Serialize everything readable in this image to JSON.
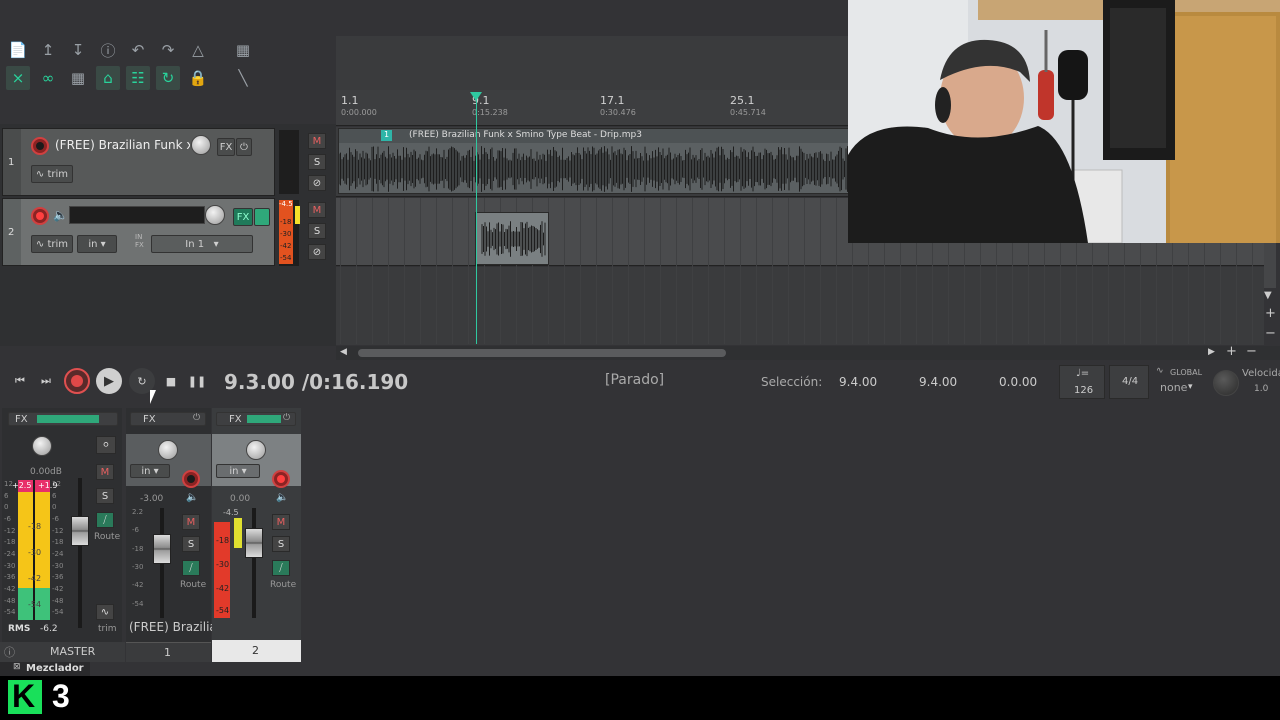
{
  "toolbar": {
    "icons_row1": [
      "new-file-icon",
      "open-icon",
      "save-icon",
      "info-icon",
      "undo-icon",
      "redo-icon",
      "metronome-icon",
      "grid-icon"
    ],
    "icons_row2": [
      "ripple-edit-icon",
      "link-icon",
      "snap-icon",
      "lock-items-icon",
      "grid-lines-icon",
      "loop-icon",
      "lock-icon",
      "trim-tool-icon"
    ]
  },
  "tracks": [
    {
      "number": "1",
      "name": "(FREE) Brazilian Funk x S",
      "fx": "FX",
      "automation": "trim",
      "m": "M",
      "s": "S"
    },
    {
      "number": "2",
      "name": "",
      "fx": "FX",
      "automation": "trim",
      "input_label": "in",
      "input_fx": "IN FX",
      "input": "In 1",
      "m": "M",
      "s": "S",
      "meter_top": "-4.5",
      "meter_labels": [
        "-18",
        "-30",
        "-42",
        "-54"
      ]
    }
  ],
  "ruler": {
    "marks": [
      {
        "bar": "1.1",
        "time": "0:00.000"
      },
      {
        "bar": "9.1",
        "time": "0:15.238"
      },
      {
        "bar": "17.1",
        "time": "0:30.476"
      },
      {
        "bar": "25.1",
        "time": "0:45.714"
      }
    ]
  },
  "item": {
    "title": "(FREE) Brazilian Funk x Smino Type Beat - Drip.mp3",
    "badge": "1"
  },
  "transport": {
    "position": "9.3.00 /0:16.190",
    "status": "[Parado]",
    "selection_label": "Selección:",
    "sel_start": "9.4.00",
    "sel_end": "9.4.00",
    "sel_length": "0.0.00",
    "bpm": "126",
    "bpm_icon": "♩=",
    "time_sig": "4/4",
    "global_label": "GLOBAL",
    "global_value": "none",
    "rate_label": "Velocidad",
    "rate_value": "1.0"
  },
  "mixer": {
    "master": {
      "fx": "FX",
      "volume": "0.00dB",
      "peak_l": "+2.5",
      "peak_r": "+1.9",
      "scale": [
        "12",
        "6",
        "0",
        "-6",
        "-12",
        "-18",
        "-24",
        "-30",
        "-36",
        "-42",
        "-48",
        "-54"
      ],
      "meter_labels": [
        "-18",
        "-30",
        "-42",
        "-54"
      ],
      "m": "M",
      "s": "S",
      "route": "Route",
      "trim": "trim",
      "rms_label": "RMS",
      "rms_value": "-6.2",
      "name": "MASTER"
    },
    "channels": [
      {
        "number": "1",
        "fx": "FX",
        "input": "in",
        "volume": "-3.00",
        "scale": [
          "2.2",
          "-6",
          "-18",
          "-30",
          "-42",
          "-54"
        ],
        "m": "M",
        "s": "S",
        "route": "Route",
        "name": "(FREE) Brazilia"
      },
      {
        "number": "2",
        "fx": "FX",
        "input": "in",
        "volume": "0.00",
        "meter_top": "-4.5",
        "meter_labels": [
          "-18",
          "-30",
          "-42",
          "-54"
        ],
        "m": "M",
        "s": "S",
        "route": "Route",
        "name": ""
      }
    ],
    "tab_label": "Mezclador"
  },
  "overlay": {
    "logo_letter": "K",
    "logo_number": "3"
  },
  "colors": {
    "accent": "#29d39b",
    "record": "#d04040",
    "meter_yellow": "#f5c518",
    "meter_red": "#e23a2a",
    "meter_green": "#3ec27a"
  }
}
